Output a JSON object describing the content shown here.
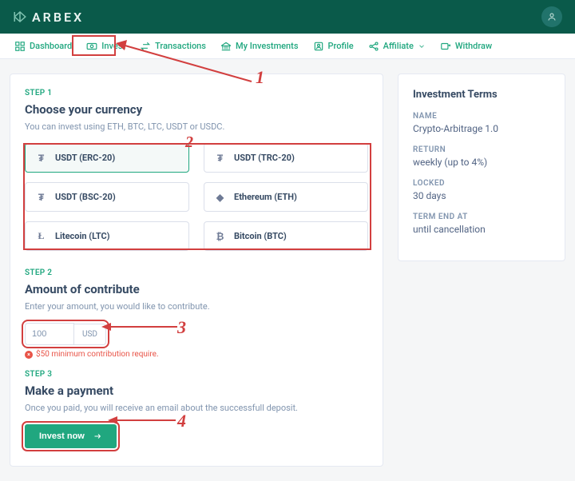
{
  "brand": "ARBEX",
  "nav": [
    {
      "label": "Dashboard"
    },
    {
      "label": "Invest"
    },
    {
      "label": "Transactions"
    },
    {
      "label": "My Investments"
    },
    {
      "label": "Profile"
    },
    {
      "label": "Affiliate"
    },
    {
      "label": "Withdraw"
    }
  ],
  "step1": {
    "label": "STEP 1",
    "title": "Choose your currency",
    "desc": "You can invest using ETH, BTC, LTC, USDT or USDC.",
    "options": [
      "USDT (ERC-20)",
      "USDT (TRC-20)",
      "USDT (BSC-20)",
      "Ethereum (ETH)",
      "Litecoin (LTC)",
      "Bitcoin (BTC)"
    ]
  },
  "step2": {
    "label": "STEP 2",
    "title": "Amount of contribute",
    "desc": "Enter your amount, you would like to contribute.",
    "value": "100",
    "unit": "USD",
    "hint": "$50 minimum contribution require."
  },
  "step3": {
    "label": "STEP 3",
    "title": "Make a payment",
    "desc": "Once you paid, you will receive an email about the successfull deposit.",
    "button": "Invest now"
  },
  "terms": {
    "title": "Investment Terms",
    "name_label": "NAME",
    "name": "Crypto-Arbitrage 1.0",
    "return_label": "RETURN",
    "return": "weekly (up to 4%)",
    "locked_label": "LOCKED",
    "locked": "30 days",
    "termend_label": "TERM END AT",
    "termend": "until cancellation"
  },
  "annotations": {
    "n1": "1",
    "n2": "2",
    "n3": "3",
    "n4": "4"
  }
}
